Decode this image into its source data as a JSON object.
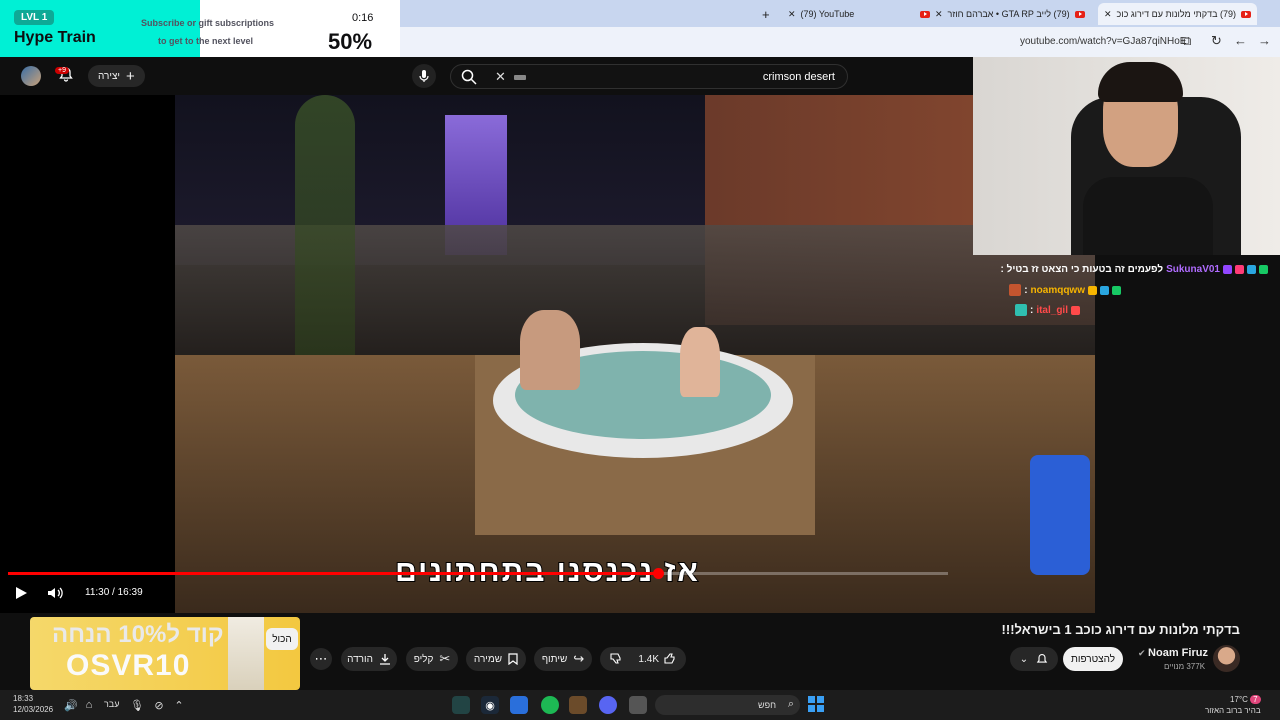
{
  "browser": {
    "tabs": [
      {
        "label": "(79) YouTube"
      },
      {
        "label": "(79) לייב GTA RP • אברהם חוזר"
      },
      {
        "label": "(79) בדקתי מלונות עם דירוג כוכ"
      }
    ],
    "new_tab": "+",
    "url": "youtube.com/watch?v=GJa87qiNHoE"
  },
  "hype_train": {
    "level": "LVL 1",
    "title": "Hype Train",
    "subtitle_line1": "Subscribe or gift subscriptions",
    "subtitle_line2": "to get to the next level",
    "timer": "0:16",
    "progress_label": "50%",
    "progress": 0.5
  },
  "yt_header": {
    "notifications_badge": "+9",
    "create_label": "יצירה",
    "search_query": "crimson desert"
  },
  "player": {
    "subtitle": "אז נכנסנו בתחתונים",
    "time": "11:30 / 16:39",
    "progress_fraction": 0.6917
  },
  "chat": {
    "messages": [
      {
        "user": "SukunaV01",
        "text": "לפעמים זה בטעות כי הצאט זז בטיל :",
        "color": "#b06cff"
      },
      {
        "user": "noamqqww",
        "text": ":",
        "color": "#f7b500"
      },
      {
        "user": "ital_gil",
        "text": ":",
        "color": "#ff4a4a"
      }
    ]
  },
  "promo": {
    "line1": "קוד ל10% הנחה",
    "line2": "OSVR10"
  },
  "below_video": {
    "all_chip": "הכול",
    "download": "הורדה",
    "clip": "קליפ",
    "save": "שמירה",
    "share": "שיתוף",
    "likes": "1.4K",
    "title": "בדקתי מלונות עם דירוג כוכב 1 בישראל!!!",
    "channel_name": "Noam Firuz",
    "channel_subs": "377K מנויים",
    "subscribe": "להצטרפות"
  },
  "taskbar": {
    "time": "18:33",
    "date": "12/03/2026",
    "lang": "עבר",
    "search_placeholder": "חפש",
    "weather_temp": "17°C",
    "weather_desc": "בהיר ברוב האזור",
    "weather_badge": "7"
  }
}
